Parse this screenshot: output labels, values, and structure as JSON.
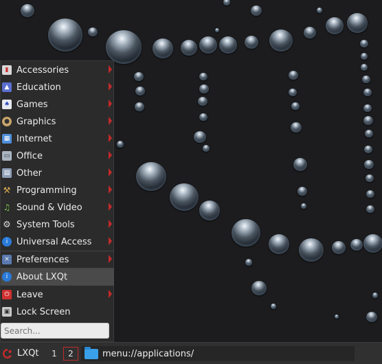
{
  "menu": {
    "items": [
      {
        "label": "Accessories",
        "icon": "accessories-icon",
        "submenu": true
      },
      {
        "label": "Education",
        "icon": "education-icon",
        "submenu": true
      },
      {
        "label": "Games",
        "icon": "games-icon",
        "submenu": true
      },
      {
        "label": "Graphics",
        "icon": "graphics-icon",
        "submenu": true
      },
      {
        "label": "Internet",
        "icon": "internet-icon",
        "submenu": true
      },
      {
        "label": "Office",
        "icon": "office-icon",
        "submenu": true
      },
      {
        "label": "Other",
        "icon": "other-icon",
        "submenu": true
      },
      {
        "label": "Programming",
        "icon": "programming-icon",
        "submenu": true
      },
      {
        "label": "Sound & Video",
        "icon": "sound-video-icon",
        "submenu": true
      },
      {
        "label": "System Tools",
        "icon": "system-tools-icon",
        "submenu": true
      },
      {
        "label": "Universal Access",
        "icon": "universal-access-icon",
        "submenu": true
      },
      {
        "label": "Preferences",
        "icon": "preferences-icon",
        "submenu": true
      },
      {
        "label": "About LXQt",
        "icon": "about-icon",
        "submenu": false,
        "highlighted": true
      },
      {
        "label": "Leave",
        "icon": "leave-icon",
        "submenu": true
      },
      {
        "label": "Lock Screen",
        "icon": "lock-screen-icon",
        "submenu": false
      }
    ],
    "search": {
      "placeholder": "Search..."
    }
  },
  "panel": {
    "start_label": "LXQt",
    "desktops": [
      "1",
      "2"
    ],
    "active_desktop": "2",
    "task_title": "menu://applications/"
  },
  "colors": {
    "accent": "#c32a2a",
    "menu_bg": "#2b2b2b",
    "panel_bg": "#303030",
    "highlight": "#4a4a4a",
    "desktop_bg": "#1c1c1e"
  }
}
